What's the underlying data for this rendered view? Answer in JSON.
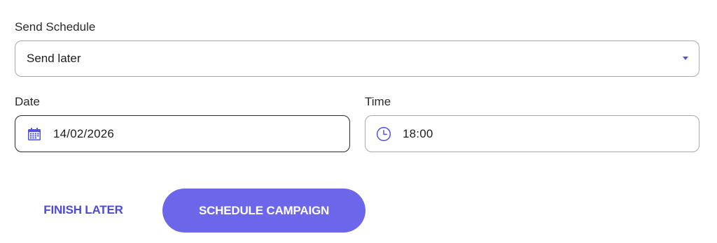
{
  "send_schedule": {
    "label": "Send Schedule",
    "selected": "Send later"
  },
  "date": {
    "label": "Date",
    "value": "14/02/2026",
    "icon": "calendar-icon"
  },
  "time": {
    "label": "Time",
    "value": "18:00",
    "icon": "clock-icon"
  },
  "actions": {
    "finish_later": "FINISH LATER",
    "schedule_campaign": "SCHEDULE CAMPAIGN"
  },
  "colors": {
    "accent": "#4f50e6",
    "primary_button": "#6c66ea",
    "text_button": "#4a4bd8",
    "border": "#a9a9ae",
    "active_border": "#2b2b2e"
  }
}
